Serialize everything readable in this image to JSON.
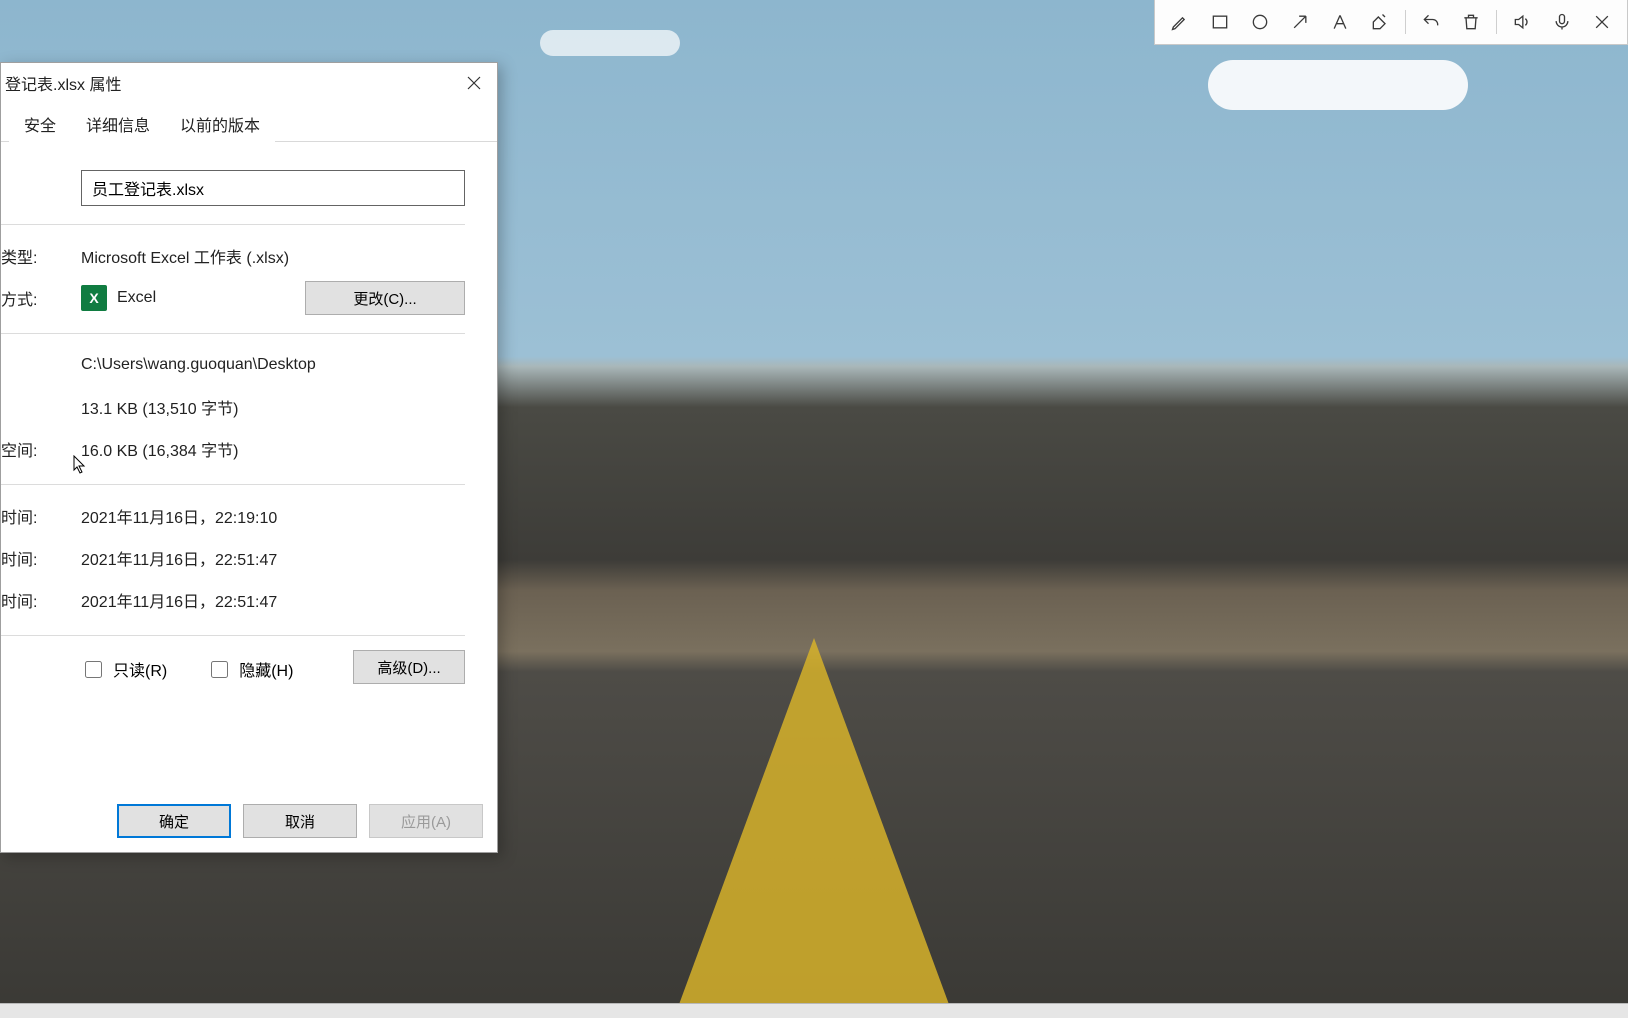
{
  "toolbar": {
    "tools": [
      "pencil",
      "rect",
      "circle",
      "arrow",
      "text",
      "highlight",
      "undo",
      "trash",
      "sound",
      "mic",
      "close"
    ]
  },
  "dialog": {
    "title": "登记表.xlsx 属性",
    "tabs": {
      "security": "安全",
      "details": "详细信息",
      "previous": "以前的版本"
    },
    "filename": "员工登记表.xlsx",
    "labels": {
      "type": "类型:",
      "openwith": "方式:",
      "location_partial": "",
      "size_partial": "",
      "size_on_disk": "空间:",
      "created": "时间:",
      "modified": "时间:",
      "accessed": "时间:"
    },
    "values": {
      "type": "Microsoft Excel 工作表 (.xlsx)",
      "app": "Excel",
      "change_btn": "更改(C)...",
      "location": "C:\\Users\\wang.guoquan\\Desktop",
      "size": "13.1 KB (13,510 字节)",
      "size_on_disk": "16.0 KB (16,384 字节)",
      "created": "2021年11月16日，22:19:10",
      "modified": "2021年11月16日，22:51:47",
      "accessed": "2021年11月16日，22:51:47"
    },
    "attributes": {
      "readonly": "只读(R)",
      "hidden": "隐藏(H)",
      "advanced_btn": "高级(D)..."
    },
    "buttons": {
      "ok": "确定",
      "cancel": "取消",
      "apply": "应用(A)"
    }
  }
}
